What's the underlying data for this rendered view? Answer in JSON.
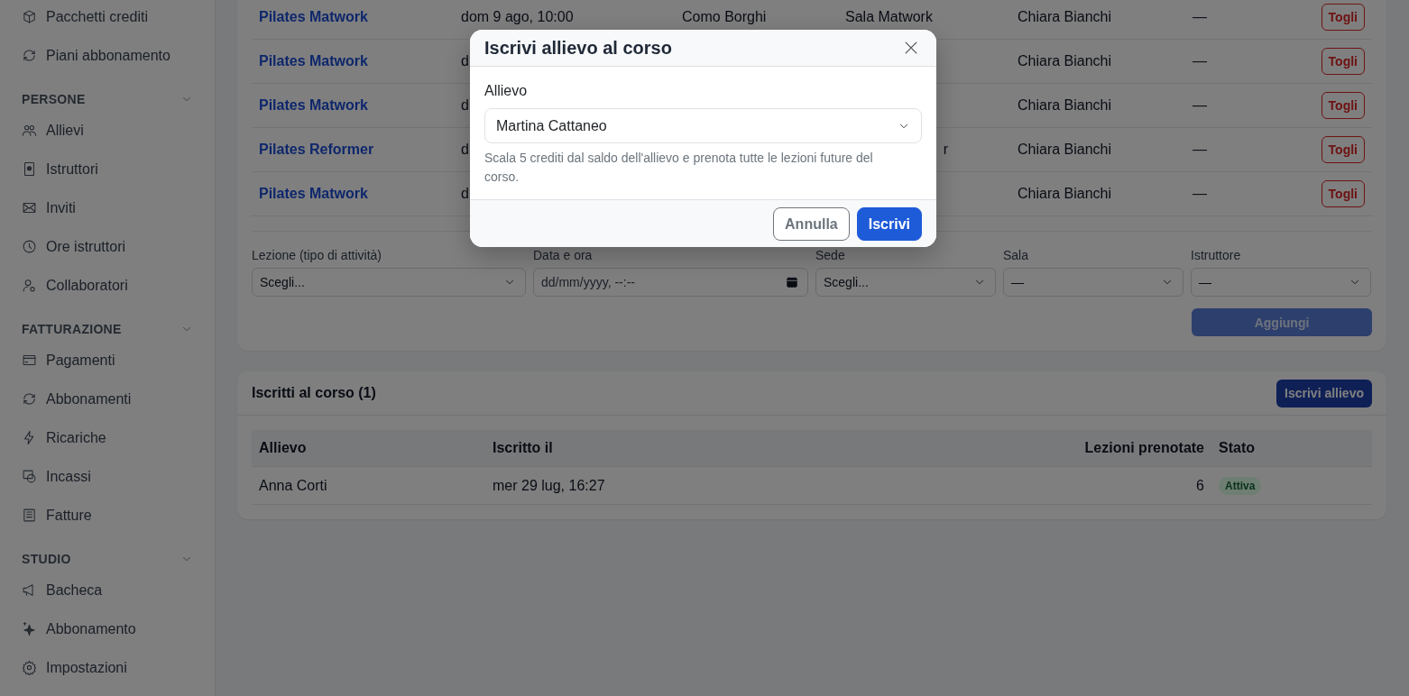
{
  "sidebar": {
    "sections": [
      {
        "items": [
          {
            "label": "Pacchetti crediti"
          },
          {
            "label": "Piani abbonamento"
          }
        ]
      },
      {
        "title": "PERSONE",
        "expanded": true,
        "items": [
          {
            "label": "Allievi"
          },
          {
            "label": "Istruttori"
          },
          {
            "label": "Inviti"
          },
          {
            "label": "Ore istruttori"
          },
          {
            "label": "Collaboratori"
          }
        ]
      },
      {
        "title": "FATTURAZIONE",
        "expanded": true,
        "items": [
          {
            "label": "Pagamenti"
          },
          {
            "label": "Abbonamenti"
          },
          {
            "label": "Ricariche"
          },
          {
            "label": "Incassi"
          },
          {
            "label": "Fatture"
          }
        ]
      },
      {
        "title": "STUDIO",
        "expanded": true,
        "items": [
          {
            "label": "Bacheca"
          },
          {
            "label": "Abbonamento"
          },
          {
            "label": "Impostazioni"
          }
        ]
      }
    ]
  },
  "lessons": {
    "rows": [
      {
        "lesson": "Pilates Matwork",
        "date": "dom 9 ago, 10:00",
        "venue": "Como Borghi",
        "room": "Sala Matwork",
        "instructor": "Chiara Bianchi",
        "column_6": "—",
        "action": "Togli"
      },
      {
        "lesson": "Pilates Matwork",
        "date": "d",
        "instructor": "Chiara Bianchi",
        "column_6": "—",
        "action": "Togli"
      },
      {
        "lesson": "Pilates Matwork",
        "date": "d",
        "instructor": "Chiara Bianchi",
        "column_6": "—",
        "action": "Togli"
      },
      {
        "lesson": "Pilates Reformer",
        "date": "d",
        "room_tail": "r",
        "instructor": "Chiara Bianchi",
        "column_6": "—",
        "action": "Togli"
      },
      {
        "lesson": "Pilates Matwork",
        "date": "d",
        "instructor": "Chiara Bianchi",
        "column_6": "—",
        "action": "Togli"
      }
    ],
    "add_form": {
      "fields": [
        {
          "label": "Lezione (tipo di attività)",
          "kind": "select",
          "value": "Scegli..."
        },
        {
          "label": "Data e ora",
          "kind": "datetime",
          "placeholder": "dd/mm/yyyy, --:--"
        },
        {
          "label": "Sede",
          "kind": "select",
          "value": "Scegli..."
        },
        {
          "label": "Sala",
          "kind": "select",
          "value": "—"
        },
        {
          "label": "Istruttore",
          "kind": "select",
          "value": "—"
        }
      ],
      "button": {
        "label": "Aggiungi",
        "disabled": true
      }
    }
  },
  "enrolled": {
    "title": "Iscritti al corso (1)",
    "button": "Iscrivi allievo",
    "columns": [
      "Allievo",
      "Iscritto il",
      "Lezioni prenotate",
      "Stato"
    ],
    "rows": [
      {
        "student": "Anna Corti",
        "enrolled_on": "mer 29 lug, 16:27",
        "booked": "6",
        "status": "Attiva"
      }
    ]
  },
  "modal": {
    "title": "Iscrivi allievo al corso",
    "field": {
      "label": "Allievo",
      "value": "Martina Cattaneo"
    },
    "help": "Scala 5 crediti dal saldo dell'allievo e prenota tutte le lezioni future del corso.",
    "buttons": [
      {
        "label": "Annulla",
        "kind": "secondary"
      },
      {
        "label": "Iscrivi",
        "kind": "primary"
      }
    ]
  }
}
